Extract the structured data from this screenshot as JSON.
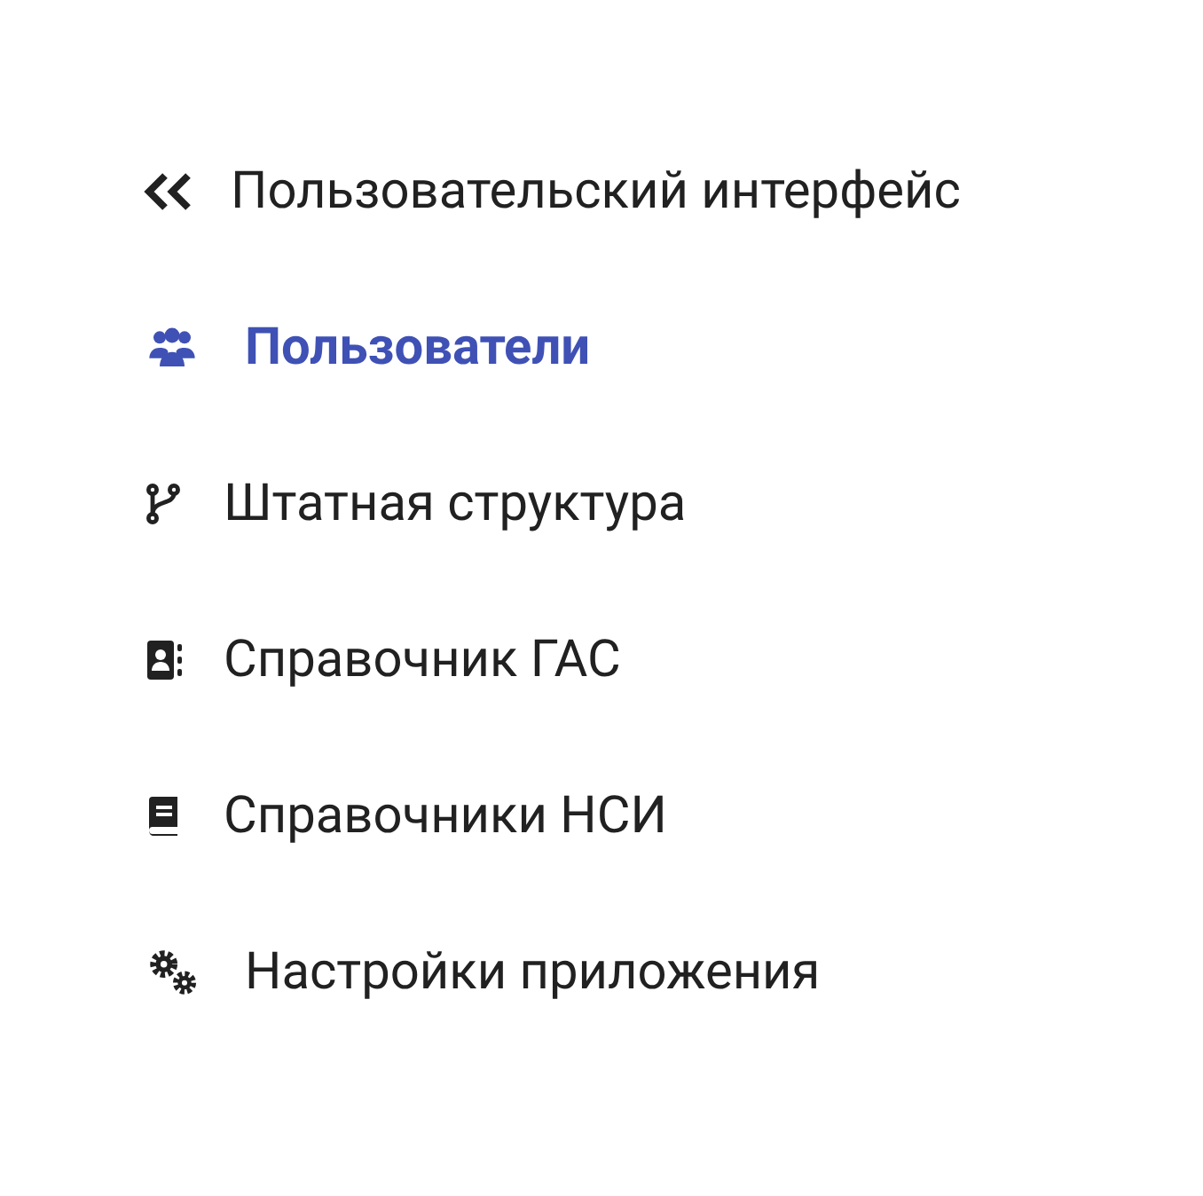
{
  "header": {
    "label": "Пользовательский интерфейс"
  },
  "menu": [
    {
      "kind": "users",
      "label": "Пользователи",
      "selected": true
    },
    {
      "kind": "branch",
      "label": "Штатная структура",
      "selected": false
    },
    {
      "kind": "contacts",
      "label": "Справочник ГАС",
      "selected": false
    },
    {
      "kind": "book",
      "label": "Справочники НСИ",
      "selected": false
    },
    {
      "kind": "gears",
      "label": "Настройки приложения",
      "selected": false
    }
  ]
}
